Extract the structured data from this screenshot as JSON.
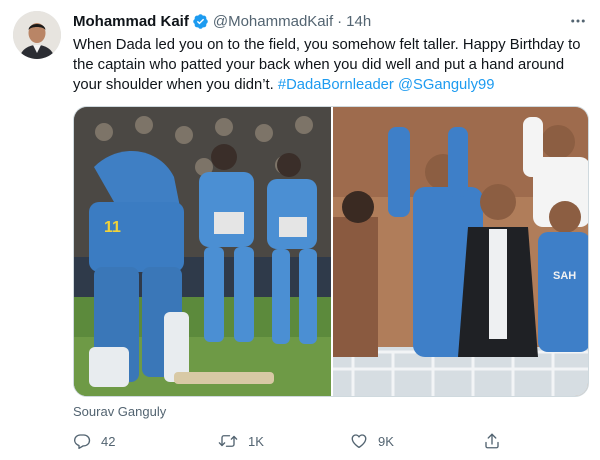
{
  "author": {
    "display_name": "Mohammad Kaif",
    "handle": "@MohammadKaif",
    "separator": "·",
    "time": "14h",
    "verified_icon": "verified-badge-icon"
  },
  "tweet": {
    "text_main": "When Dada led you on to the field, you somehow felt taller. Happy Birthday to the captain who patted your back when you did well and put a hand around your shoulder when you didn’t.",
    "hashtag": "#DadaBornleader",
    "mention": "@SGanguly99",
    "link_color": "#1d9bf0"
  },
  "media": {
    "caption": "Sourav Ganguly"
  },
  "actions": {
    "reply_count": "42",
    "retweet_count": "1K",
    "like_count": "9K"
  },
  "icons": {
    "more": "more-dots-icon",
    "reply": "reply-bubble-icon",
    "retweet": "retweet-arrows-icon",
    "like": "heart-icon",
    "share": "share-upload-icon"
  },
  "colors": {
    "text_primary": "#0f1419",
    "text_secondary": "#536471",
    "accent": "#1d9bf0",
    "border": "#cfd9de"
  }
}
